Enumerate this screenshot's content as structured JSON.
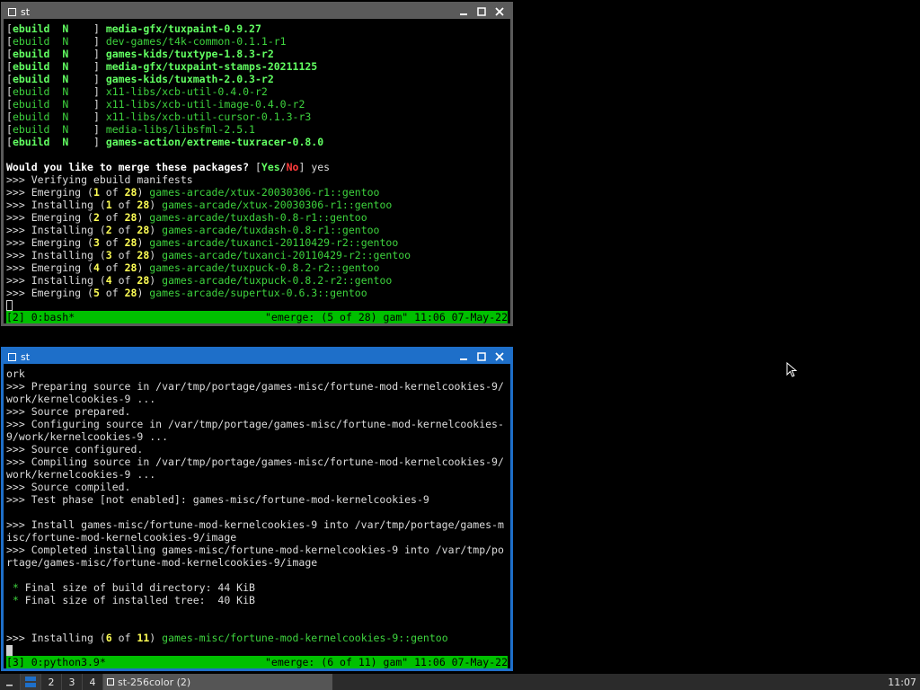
{
  "windows": {
    "top": {
      "title": "st",
      "lines": [
        [
          [
            "[",
            ""
          ],
          [
            "ebuild  N    ",
            "gb"
          ],
          [
            "] ",
            ""
          ],
          [
            "media-gfx/tuxpaint-0.9.27",
            "gb"
          ]
        ],
        [
          [
            "[",
            ""
          ],
          [
            "ebuild  N    ",
            "g"
          ],
          [
            "] ",
            ""
          ],
          [
            "dev-games/t4k-common-0.1.1-r1",
            "g"
          ]
        ],
        [
          [
            "[",
            ""
          ],
          [
            "ebuild  N    ",
            "gb"
          ],
          [
            "] ",
            ""
          ],
          [
            "games-kids/tuxtype-1.8.3-r2",
            "gb"
          ]
        ],
        [
          [
            "[",
            ""
          ],
          [
            "ebuild  N    ",
            "gb"
          ],
          [
            "] ",
            ""
          ],
          [
            "media-gfx/tuxpaint-stamps-20211125",
            "gb"
          ]
        ],
        [
          [
            "[",
            ""
          ],
          [
            "ebuild  N    ",
            "gb"
          ],
          [
            "] ",
            ""
          ],
          [
            "games-kids/tuxmath-2.0.3-r2",
            "gb"
          ]
        ],
        [
          [
            "[",
            ""
          ],
          [
            "ebuild  N    ",
            "g"
          ],
          [
            "] ",
            ""
          ],
          [
            "x11-libs/xcb-util-0.4.0-r2",
            "g"
          ]
        ],
        [
          [
            "[",
            ""
          ],
          [
            "ebuild  N    ",
            "g"
          ],
          [
            "] ",
            ""
          ],
          [
            "x11-libs/xcb-util-image-0.4.0-r2",
            "g"
          ]
        ],
        [
          [
            "[",
            ""
          ],
          [
            "ebuild  N    ",
            "g"
          ],
          [
            "] ",
            ""
          ],
          [
            "x11-libs/xcb-util-cursor-0.1.3-r3",
            "g"
          ]
        ],
        [
          [
            "[",
            ""
          ],
          [
            "ebuild  N    ",
            "g"
          ],
          [
            "] ",
            ""
          ],
          [
            "media-libs/libsfml-2.5.1",
            "g"
          ]
        ],
        [
          [
            "[",
            ""
          ],
          [
            "ebuild  N    ",
            "gb"
          ],
          [
            "] ",
            ""
          ],
          [
            "games-action/extreme-tuxracer-0.8.0",
            "gb"
          ]
        ],
        [],
        [
          [
            "Would you like to merge these packages? ",
            "b"
          ],
          [
            "[",
            ""
          ],
          [
            "Yes",
            "gb"
          ],
          [
            "/",
            ""
          ],
          [
            "No",
            "r"
          ],
          [
            "] yes",
            ""
          ]
        ],
        [
          [
            ">>> Verifying ebuild manifests",
            ""
          ]
        ],
        [
          [
            ">>> Emerging (",
            ""
          ],
          [
            "1",
            "y"
          ],
          [
            " of ",
            ""
          ],
          [
            "28",
            "y"
          ],
          [
            ") ",
            ""
          ],
          [
            "games-arcade/xtux-20030306-r1::gentoo",
            "g"
          ]
        ],
        [
          [
            ">>> Installing (",
            ""
          ],
          [
            "1",
            "y"
          ],
          [
            " of ",
            ""
          ],
          [
            "28",
            "y"
          ],
          [
            ") ",
            ""
          ],
          [
            "games-arcade/xtux-20030306-r1::gentoo",
            "g"
          ]
        ],
        [
          [
            ">>> Emerging (",
            ""
          ],
          [
            "2",
            "y"
          ],
          [
            " of ",
            ""
          ],
          [
            "28",
            "y"
          ],
          [
            ") ",
            ""
          ],
          [
            "games-arcade/tuxdash-0.8-r1::gentoo",
            "g"
          ]
        ],
        [
          [
            ">>> Installing (",
            ""
          ],
          [
            "2",
            "y"
          ],
          [
            " of ",
            ""
          ],
          [
            "28",
            "y"
          ],
          [
            ") ",
            ""
          ],
          [
            "games-arcade/tuxdash-0.8-r1::gentoo",
            "g"
          ]
        ],
        [
          [
            ">>> Emerging (",
            ""
          ],
          [
            "3",
            "y"
          ],
          [
            " of ",
            ""
          ],
          [
            "28",
            "y"
          ],
          [
            ") ",
            ""
          ],
          [
            "games-arcade/tuxanci-20110429-r2::gentoo",
            "g"
          ]
        ],
        [
          [
            ">>> Installing (",
            ""
          ],
          [
            "3",
            "y"
          ],
          [
            " of ",
            ""
          ],
          [
            "28",
            "y"
          ],
          [
            ") ",
            ""
          ],
          [
            "games-arcade/tuxanci-20110429-r2::gentoo",
            "g"
          ]
        ],
        [
          [
            ">>> Emerging (",
            ""
          ],
          [
            "4",
            "y"
          ],
          [
            " of ",
            ""
          ],
          [
            "28",
            "y"
          ],
          [
            ") ",
            ""
          ],
          [
            "games-arcade/tuxpuck-0.8.2-r2::gentoo",
            "g"
          ]
        ],
        [
          [
            ">>> Installing (",
            ""
          ],
          [
            "4",
            "y"
          ],
          [
            " of ",
            ""
          ],
          [
            "28",
            "y"
          ],
          [
            ") ",
            ""
          ],
          [
            "games-arcade/tuxpuck-0.8.2-r2::gentoo",
            "g"
          ]
        ],
        [
          [
            ">>> Emerging (",
            ""
          ],
          [
            "5",
            "y"
          ],
          [
            " of ",
            ""
          ],
          [
            "28",
            "y"
          ],
          [
            ") ",
            ""
          ],
          [
            "games-arcade/supertux-0.6.3::gentoo",
            "g"
          ]
        ]
      ],
      "status_left": "[2] 0:bash*",
      "status_right": "\"emerge: (5 of 28) gam\" 11:06 07-May-22"
    },
    "bottom": {
      "title": "st",
      "lines": [
        [
          [
            "ork",
            ""
          ]
        ],
        [
          [
            ">>> Preparing source in /var/tmp/portage/games-misc/fortune-mod-kernelcookies-9/",
            ""
          ]
        ],
        [
          [
            "work/kernelcookies-9 ...",
            ""
          ]
        ],
        [
          [
            ">>> Source prepared.",
            ""
          ]
        ],
        [
          [
            ">>> Configuring source in /var/tmp/portage/games-misc/fortune-mod-kernelcookies-",
            ""
          ]
        ],
        [
          [
            "9/work/kernelcookies-9 ...",
            ""
          ]
        ],
        [
          [
            ">>> Source configured.",
            ""
          ]
        ],
        [
          [
            ">>> Compiling source in /var/tmp/portage/games-misc/fortune-mod-kernelcookies-9/",
            ""
          ]
        ],
        [
          [
            "work/kernelcookies-9 ...",
            ""
          ]
        ],
        [
          [
            ">>> Source compiled.",
            ""
          ]
        ],
        [
          [
            ">>> Test phase [not enabled]: games-misc/fortune-mod-kernelcookies-9",
            ""
          ]
        ],
        [],
        [
          [
            ">>> Install games-misc/fortune-mod-kernelcookies-9 into /var/tmp/portage/games-m",
            ""
          ]
        ],
        [
          [
            "isc/fortune-mod-kernelcookies-9/image",
            ""
          ]
        ],
        [
          [
            ">>> Completed installing games-misc/fortune-mod-kernelcookies-9 into /var/tmp/po",
            ""
          ]
        ],
        [
          [
            "rtage/games-misc/fortune-mod-kernelcookies-9/image",
            ""
          ]
        ],
        [],
        [
          [
            " * ",
            "g"
          ],
          [
            "Final size of build directory: 44 KiB",
            ""
          ]
        ],
        [
          [
            " * ",
            "g"
          ],
          [
            "Final size of installed tree:  40 KiB",
            ""
          ]
        ],
        [],
        [],
        [
          [
            ">>> Installing (",
            ""
          ],
          [
            "6",
            "y"
          ],
          [
            " of ",
            ""
          ],
          [
            "11",
            "y"
          ],
          [
            ") ",
            ""
          ],
          [
            "games-misc/fortune-mod-kernelcookies-9::gentoo",
            "g"
          ]
        ]
      ],
      "status_left": "[3] 0:python3.9*",
      "status_right": "\"emerge: (6 of 11) gam\" 11:06 07-May-22"
    }
  },
  "taskbar": {
    "workspaces": [
      "2",
      "3",
      "4"
    ],
    "task_label": "st-256color (2)",
    "clock": "11:07"
  }
}
